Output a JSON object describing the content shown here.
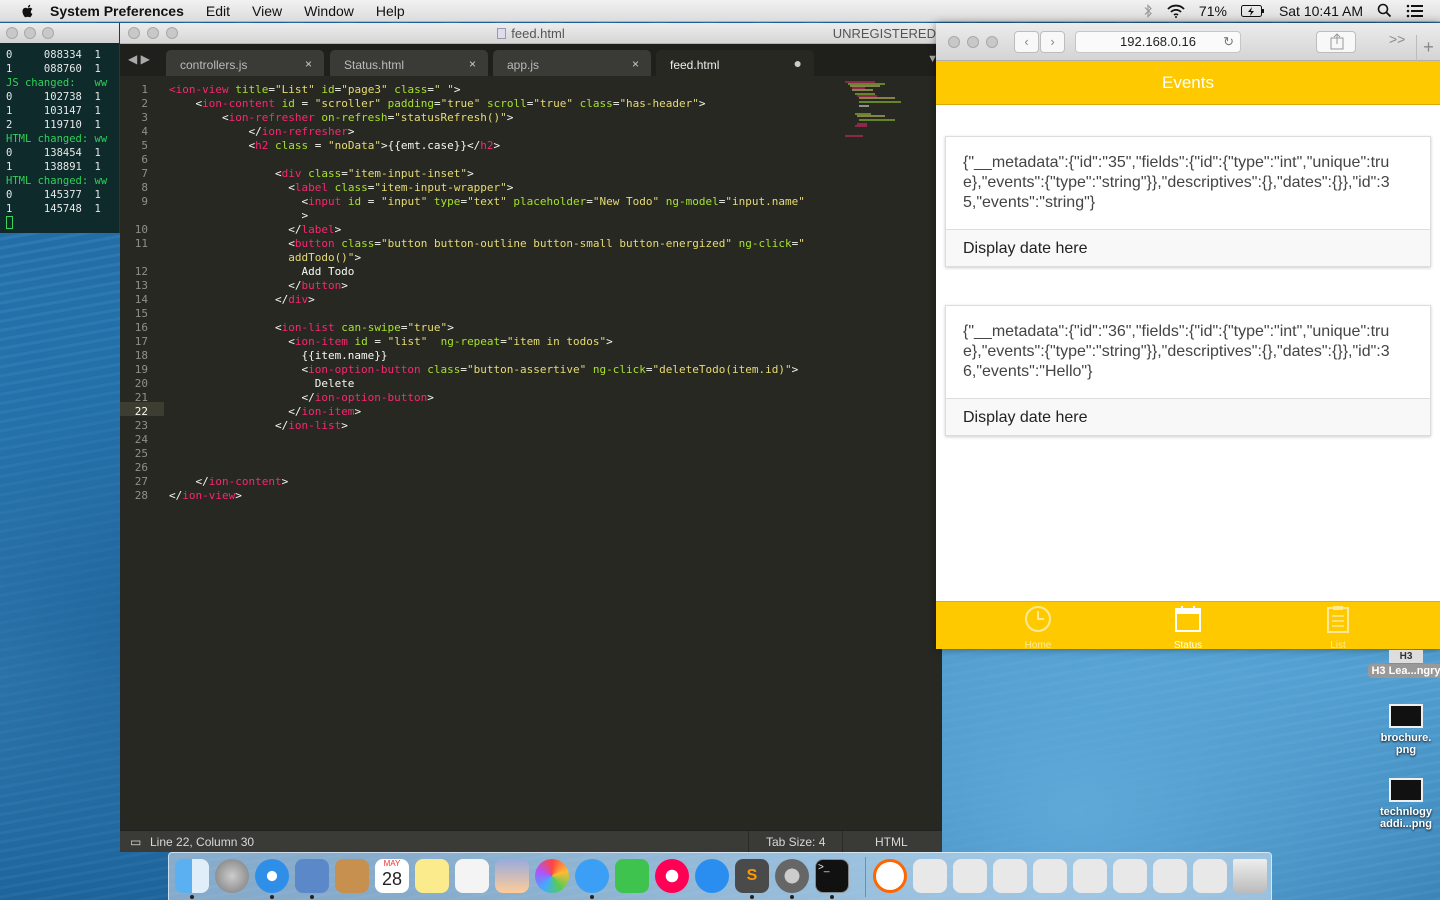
{
  "menubar": {
    "app_name": "System Preferences",
    "items": [
      "Edit",
      "View",
      "Window",
      "Help"
    ],
    "battery": "71%",
    "clock": "Sat 10:41 AM"
  },
  "terminal": {
    "lines": [
      {
        "text": "0     088334  1",
        "type": "normal"
      },
      {
        "text": "1     088760  1",
        "type": "normal"
      },
      {
        "text": "JS changed:   ww",
        "type": "changed"
      },
      {
        "text": "0     102738  1",
        "type": "normal"
      },
      {
        "text": "1     103147  1",
        "type": "normal"
      },
      {
        "text": "2     119710  1",
        "type": "normal"
      },
      {
        "text": "HTML changed: ww",
        "type": "changed"
      },
      {
        "text": "0     138454  1",
        "type": "normal"
      },
      {
        "text": "1     138891  1",
        "type": "normal"
      },
      {
        "text": "HTML changed: ww",
        "type": "changed"
      },
      {
        "text": "0     145377  1",
        "type": "normal"
      },
      {
        "text": "1     145748  1",
        "type": "normal"
      }
    ]
  },
  "editor": {
    "window_title": "feed.html",
    "unregistered": "UNREGISTERED",
    "tabs": [
      {
        "label": "controllers.js"
      },
      {
        "label": "Status.html"
      },
      {
        "label": "app.js"
      },
      {
        "label": "feed.html",
        "active": true
      }
    ],
    "close_glyph": "×",
    "modified_glyph": "●",
    "status": {
      "position": "Line 22, Column 30",
      "tab_size": "Tab Size: 4",
      "syntax": "HTML"
    },
    "current_line": "22"
  },
  "safari": {
    "url": "192.168.0.16",
    "header_title": "Events",
    "cards": [
      {
        "body": "{\"__metadata\":{\"id\":\"35\",\"fields\":{\"id\":{\"type\":\"int\",\"unique\":true},\"events\":{\"type\":\"string\"}},\"descriptives\":{},\"dates\":{}},\"id\":35,\"events\":\"string\"}",
        "footer": "Display date here"
      },
      {
        "body": "{\"__metadata\":{\"id\":\"36\",\"fields\":{\"id\":{\"type\":\"int\",\"unique\":true},\"events\":{\"type\":\"string\"}},\"descriptives\":{},\"dates\":{}},\"id\":36,\"events\":\"Hello\"}",
        "footer": "Display date here"
      }
    ],
    "tabbar": [
      {
        "label": "Home",
        "icon": "clock-icon"
      },
      {
        "label": "Status",
        "icon": "calendar-icon"
      },
      {
        "label": "List",
        "icon": "clipboard-icon"
      }
    ]
  },
  "desktop": {
    "icons": [
      {
        "label": "H3 Lea...ngry"
      },
      {
        "label": "brochure.\npng"
      },
      {
        "label": "technlogy addi...png"
      }
    ]
  },
  "dock": {
    "calendar_month": "MAY",
    "calendar_day": "28"
  },
  "colors": {
    "ionic_energized": "#ffc900",
    "sublime_bg": "#272822",
    "tag": "#f92672",
    "attr": "#a6e22e",
    "string": "#e6db74"
  }
}
